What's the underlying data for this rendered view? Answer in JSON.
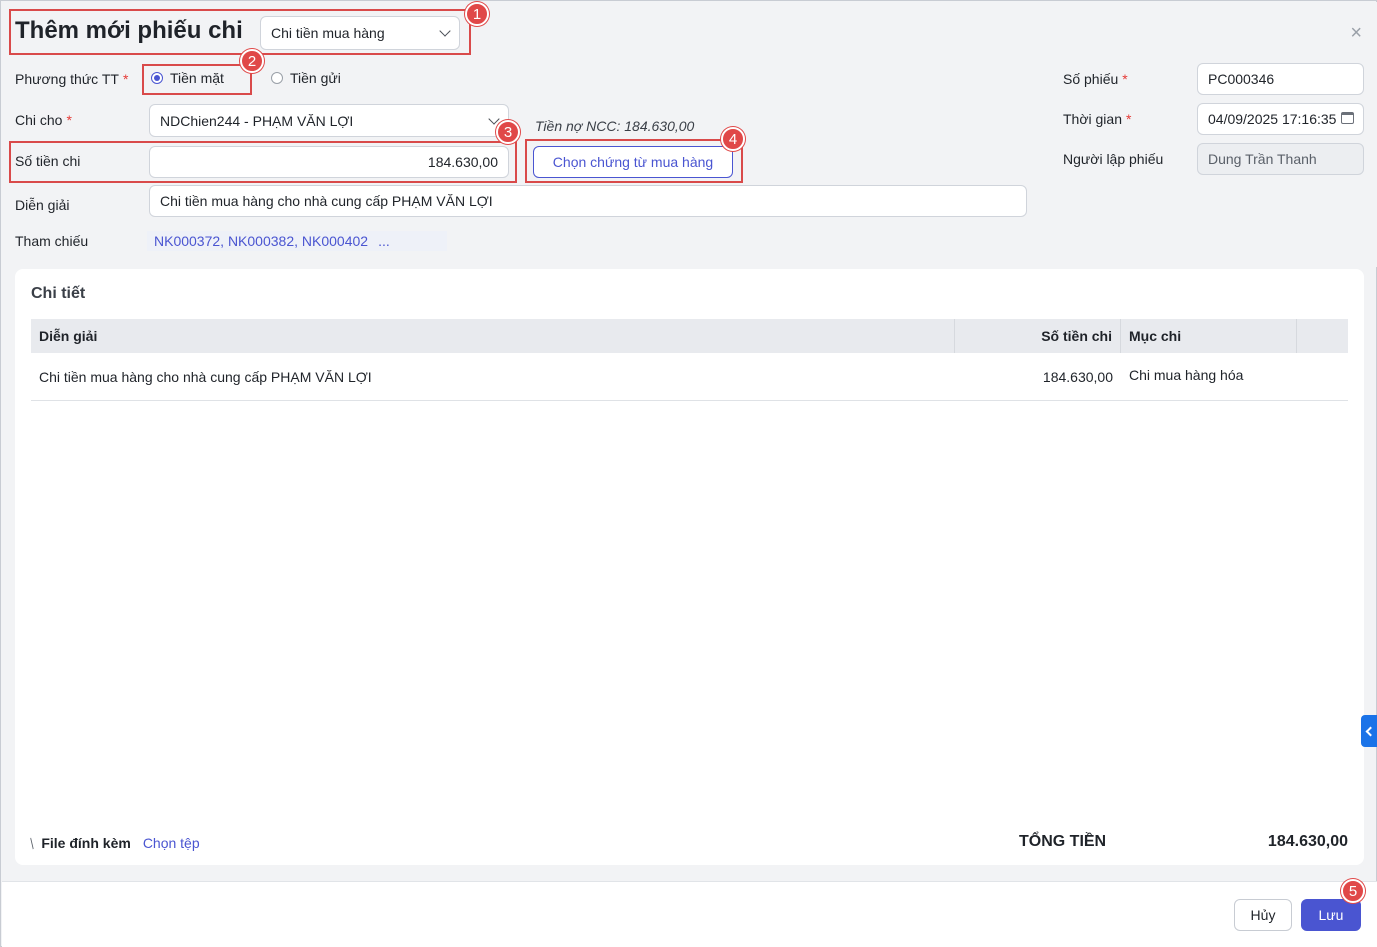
{
  "header": {
    "title": "Thêm mới phiếu chi",
    "type_select": "Chi tiền mua hàng",
    "close": "×"
  },
  "form": {
    "payment_method_label": "Phương thức TT",
    "payment_options": [
      "Tiền mặt",
      "Tiền gửi"
    ],
    "payment_selected": "Tiền mặt",
    "payee_label": "Chi cho",
    "payee_value": "NDChien244 - PHẠM VĂN LỢI",
    "debt_text": "Tiền nợ NCC: 184.630,00",
    "amount_label": "Số tiền chi",
    "amount_value": "184.630,00",
    "choose_voucher_button": "Chọn chứng từ mua hàng",
    "description_label": "Diễn giải",
    "description_value": "Chi tiền mua hàng cho nhà cung cấp PHẠM VĂN LỢI",
    "reference_label": "Tham chiếu",
    "reference_value": "NK000372, NK000382, NK000402",
    "reference_more": "...",
    "voucher_no_label": "Số phiếu",
    "voucher_no_value": "PC000346",
    "time_label": "Thời gian",
    "time_value": "04/09/2025 17:16:35",
    "creator_label": "Người lập phiếu",
    "creator_value": "Dung Trần Thanh",
    "required_mark": "*"
  },
  "detail": {
    "title": "Chi tiết",
    "columns": [
      "Diễn giải",
      "Số tiền chi",
      "Mục chi"
    ],
    "rows": [
      {
        "description": "Chi tiền mua hàng cho nhà cung cấp PHẠM VĂN LỢI",
        "amount": "184.630,00",
        "category": "Chi mua hàng hóa"
      }
    ],
    "attachment_label": "File đính kèm",
    "choose_file": "Chọn tệp",
    "total_label": "TỔNG TIỀN",
    "total_value": "184.630,00"
  },
  "footer": {
    "cancel": "Hủy",
    "save": "Lưu"
  },
  "annotations": [
    "1",
    "2",
    "3",
    "4",
    "5"
  ],
  "colors": {
    "accent": "#4a55d1",
    "highlight": "#d94a4a",
    "required": "#e53935",
    "side_tab": "#1a73e8"
  }
}
